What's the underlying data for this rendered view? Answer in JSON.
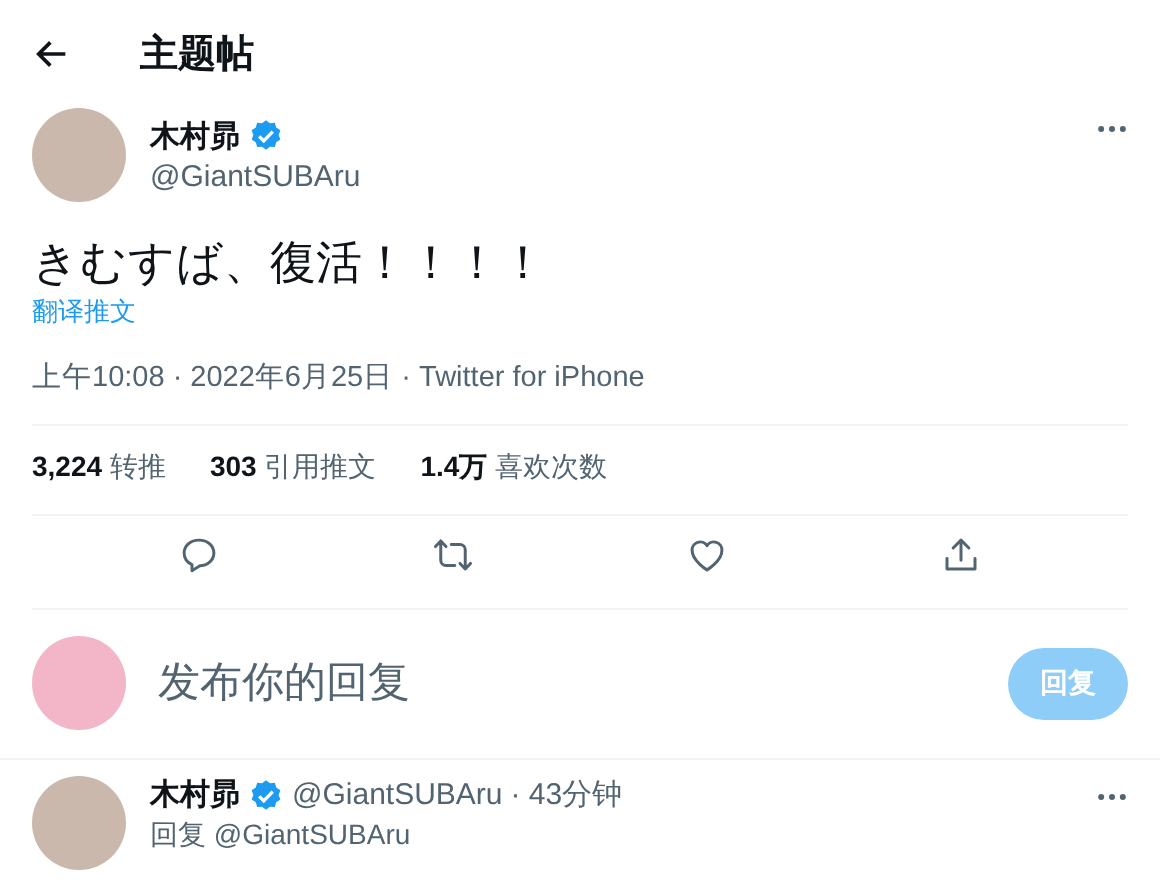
{
  "header": {
    "title": "主题帖"
  },
  "tweet": {
    "author": {
      "name": "木村昴",
      "verified": true,
      "handle": "@GiantSUBAru"
    },
    "text": "きむすば、復活！！！！",
    "translate_link": "翻译推文",
    "meta": "上午10:08 · 2022年6月25日 · Twitter for iPhone",
    "stats": [
      {
        "count": "3,224",
        "label": "转推"
      },
      {
        "count": "303",
        "label": "引用推文"
      },
      {
        "count": "1.4万",
        "label": "喜欢次数"
      }
    ],
    "actions": [
      {
        "kind": "reply"
      },
      {
        "kind": "retweet"
      },
      {
        "kind": "like"
      },
      {
        "kind": "share"
      }
    ]
  },
  "composer": {
    "placeholder": "发布你的回复",
    "button": {
      "label": "回复",
      "disabled": true
    }
  },
  "replies": [
    {
      "name": "木村昴",
      "verified": true,
      "handle": "@GiantSUBAru",
      "time": "· 43分钟",
      "replying_to": "回复 @GiantSUBAru"
    }
  ]
}
